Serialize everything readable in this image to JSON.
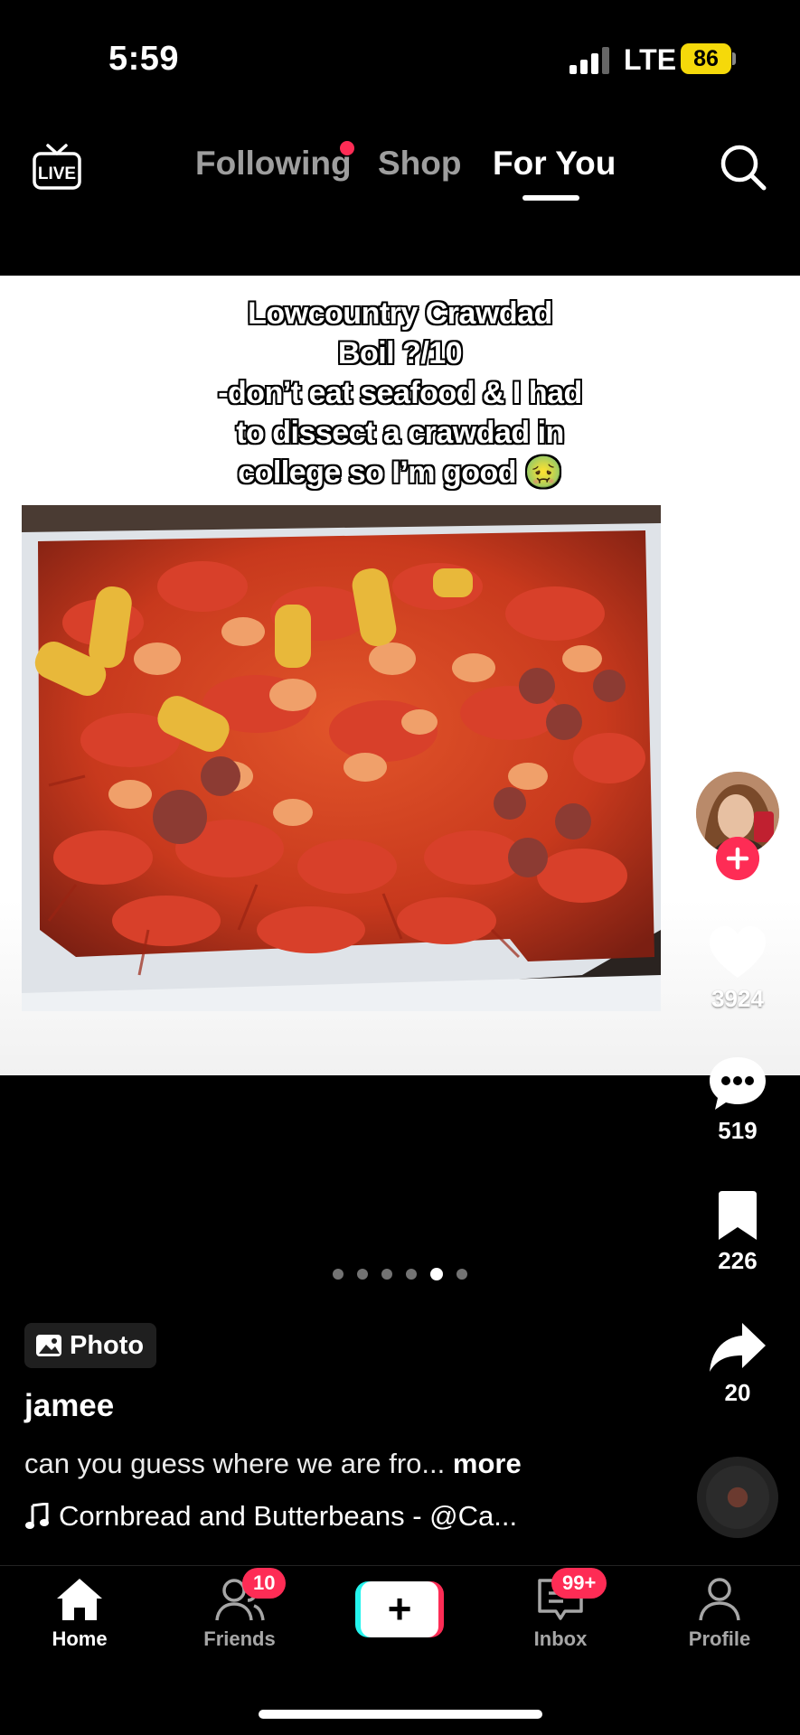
{
  "status_bar": {
    "time": "5:59",
    "network": "LTE",
    "battery": "86"
  },
  "top_nav": {
    "live_label": "LIVE",
    "tabs": [
      {
        "label": "Following",
        "has_dot": true
      },
      {
        "label": "Shop"
      },
      {
        "label": "For You",
        "active": true
      }
    ]
  },
  "post": {
    "caption_lines": [
      "Lowcountry Crawdad",
      "Boil ?/10",
      "-don’t eat seafood & I had",
      "to dissect a crawdad in",
      "college so I’m good 🤢"
    ],
    "carousel": {
      "total": 6,
      "active_index": 4
    },
    "type_badge": "Photo",
    "username": "jamee",
    "description": "can you guess where we are fro...",
    "more_label": "more",
    "sound": "Cornbread and Butterbeans - @Ca..."
  },
  "actions": {
    "likes": "3924",
    "comments": "519",
    "saves": "226",
    "shares": "20"
  },
  "tab_bar": {
    "home": "Home",
    "friends": "Friends",
    "friends_badge": "10",
    "create": "+",
    "inbox": "Inbox",
    "inbox_badge": "99+",
    "profile": "Profile"
  },
  "colors": {
    "accent": "#fe2c55",
    "cyan": "#25f4ee",
    "battery": "#f5d90a"
  }
}
